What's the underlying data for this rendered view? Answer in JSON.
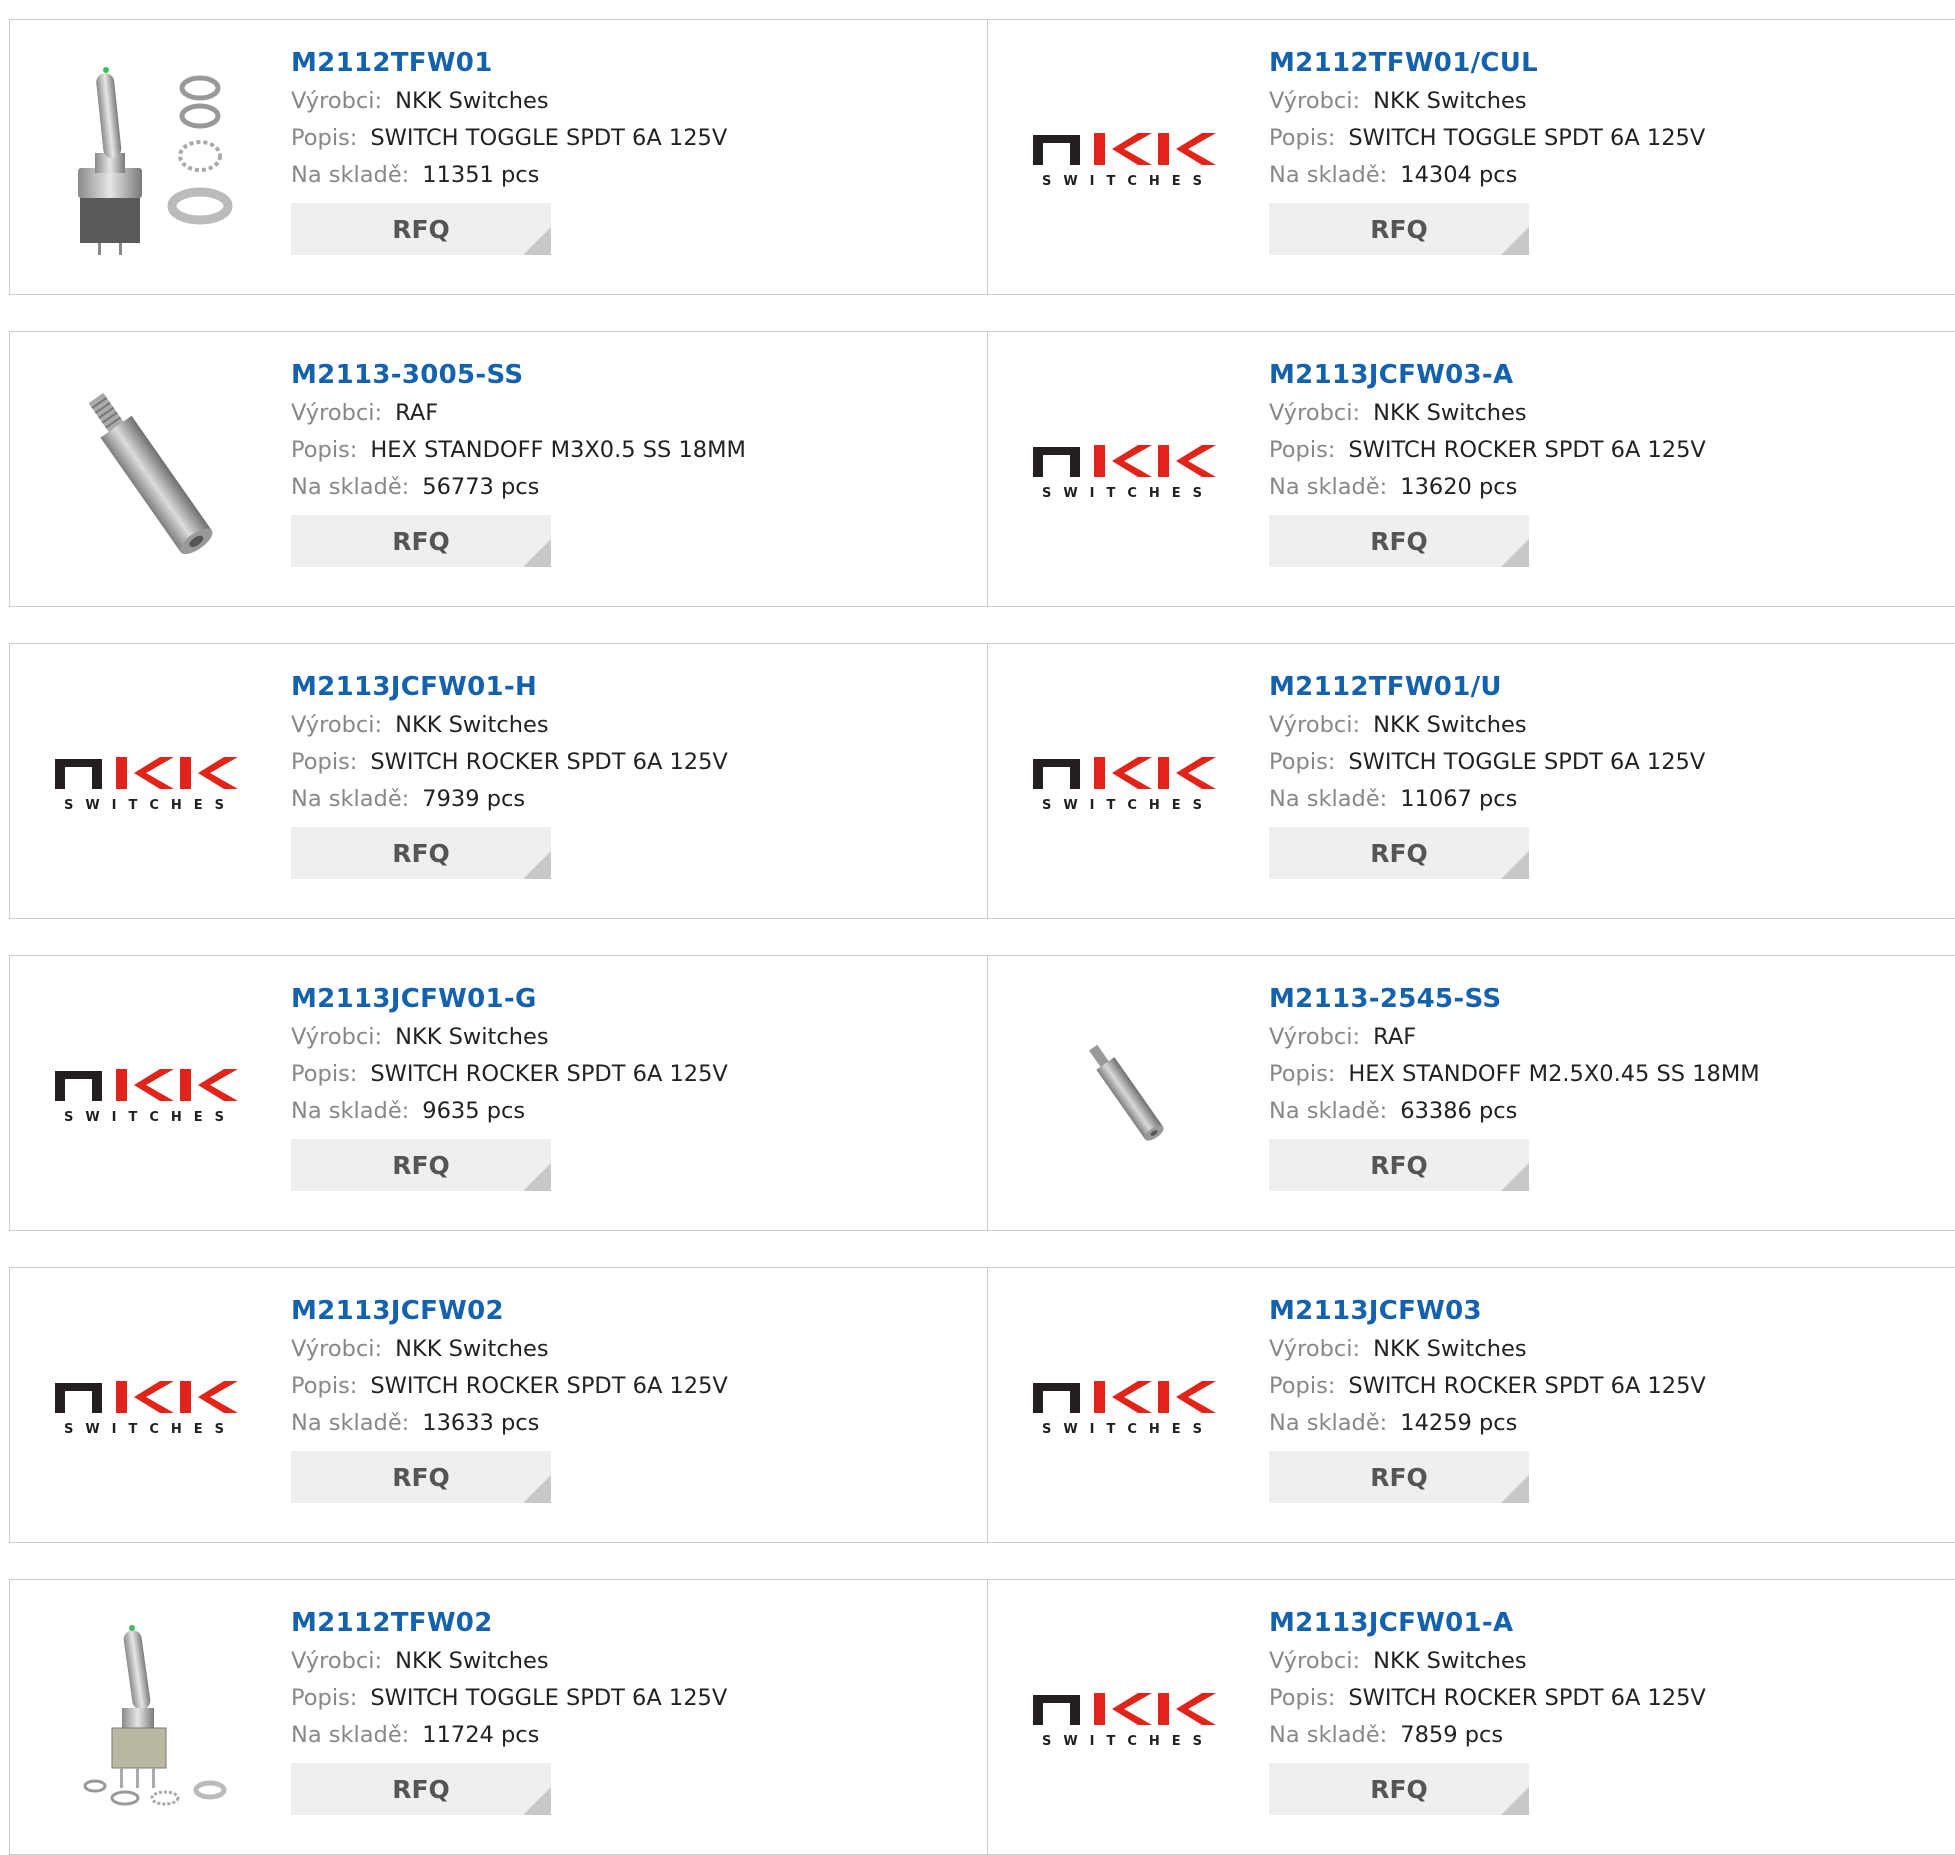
{
  "labels": {
    "manufacturer": "Výrobci:",
    "description": "Popis:",
    "stock": "Na skladě:",
    "rfq": "RFQ"
  },
  "logo_text": {
    "main": "NKK",
    "sub": "SWITCHES"
  },
  "colors": {
    "part_link": "#1462ad",
    "logo_red": "#e2231a",
    "logo_dark": "#231f20"
  },
  "products": [
    {
      "part": "M2112TFW01",
      "manufacturer": "NKK Switches",
      "description": "SWITCH TOGGLE SPDT 6A 125V",
      "stock": "11351 pcs",
      "image": "toggle-switch-with-nuts"
    },
    {
      "part": "M2112TFW01/CUL",
      "manufacturer": "NKK Switches",
      "description": "SWITCH TOGGLE SPDT 6A 125V",
      "stock": "14304 pcs",
      "image": "nkk-logo"
    },
    {
      "part": "M2113-3005-SS",
      "manufacturer": "RAF",
      "description": "HEX STANDOFF M3X0.5 SS 18MM",
      "stock": "56773 pcs",
      "image": "hex-standoff"
    },
    {
      "part": "M2113JCFW03-A",
      "manufacturer": "NKK Switches",
      "description": "SWITCH ROCKER SPDT 6A 125V",
      "stock": "13620 pcs",
      "image": "nkk-logo"
    },
    {
      "part": "M2113JCFW01-H",
      "manufacturer": "NKK Switches",
      "description": "SWITCH ROCKER SPDT 6A 125V",
      "stock": "7939 pcs",
      "image": "nkk-logo"
    },
    {
      "part": "M2112TFW01/U",
      "manufacturer": "NKK Switches",
      "description": "SWITCH TOGGLE SPDT 6A 125V",
      "stock": "11067 pcs",
      "image": "nkk-logo"
    },
    {
      "part": "M2113JCFW01-G",
      "manufacturer": "NKK Switches",
      "description": "SWITCH ROCKER SPDT 6A 125V",
      "stock": "9635 pcs",
      "image": "nkk-logo"
    },
    {
      "part": "M2113-2545-SS",
      "manufacturer": "RAF",
      "description": "HEX STANDOFF M2.5X0.45 SS 18MM",
      "stock": "63386 pcs",
      "image": "hex-standoff-small"
    },
    {
      "part": "M2113JCFW02",
      "manufacturer": "NKK Switches",
      "description": "SWITCH ROCKER SPDT 6A 125V",
      "stock": "13633 pcs",
      "image": "nkk-logo"
    },
    {
      "part": "M2113JCFW03",
      "manufacturer": "NKK Switches",
      "description": "SWITCH ROCKER SPDT 6A 125V",
      "stock": "14259 pcs",
      "image": "nkk-logo"
    },
    {
      "part": "M2112TFW02",
      "manufacturer": "NKK Switches",
      "description": "SWITCH TOGGLE SPDT 6A 125V",
      "stock": "11724 pcs",
      "image": "toggle-switch-tall"
    },
    {
      "part": "M2113JCFW01-A",
      "manufacturer": "NKK Switches",
      "description": "SWITCH ROCKER SPDT 6A 125V",
      "stock": "7859 pcs",
      "image": "nkk-logo"
    }
  ]
}
